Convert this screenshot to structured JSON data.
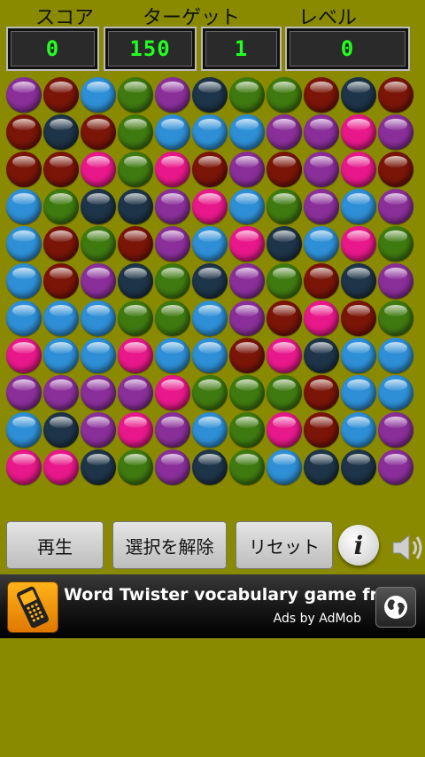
{
  "header": {
    "labels": {
      "score": "スコア",
      "target": "ターゲット",
      "level": "レベル"
    },
    "values": {
      "score": "0",
      "target": "150",
      "level": "1",
      "fourth": "0"
    }
  },
  "colors": {
    "P": "#8a2f9a",
    "R": "#7a1508",
    "B": "#2e8fd6",
    "G": "#3f7a10",
    "D": "#1e3448",
    "K": "#e8188a"
  },
  "board": [
    "PRBGPDGGRDR",
    "RDRGBBBPPKP",
    "RRKGKRPRPKR",
    "BGDDPKBGPBP",
    "BRGRPBKDBKG",
    "BRPDGDPGRDP",
    "BBBGGBPRKRG",
    "KBBKBBRKDBB",
    "PPPPKGGGRBB",
    "BDPKPBGKRBP",
    "KKDGPDGBDDP"
  ],
  "buttons": {
    "play": "再生",
    "deselect": "選択を解除",
    "reset": "リセット",
    "info": "i"
  },
  "icons": {
    "info": "info-icon",
    "sound": "speaker-icon",
    "ad_app": "phone-icon",
    "ad_globe": "globe-icon"
  },
  "ad": {
    "title": "Word Twister vocabulary game free",
    "subtitle": "Ads by AdMob"
  }
}
